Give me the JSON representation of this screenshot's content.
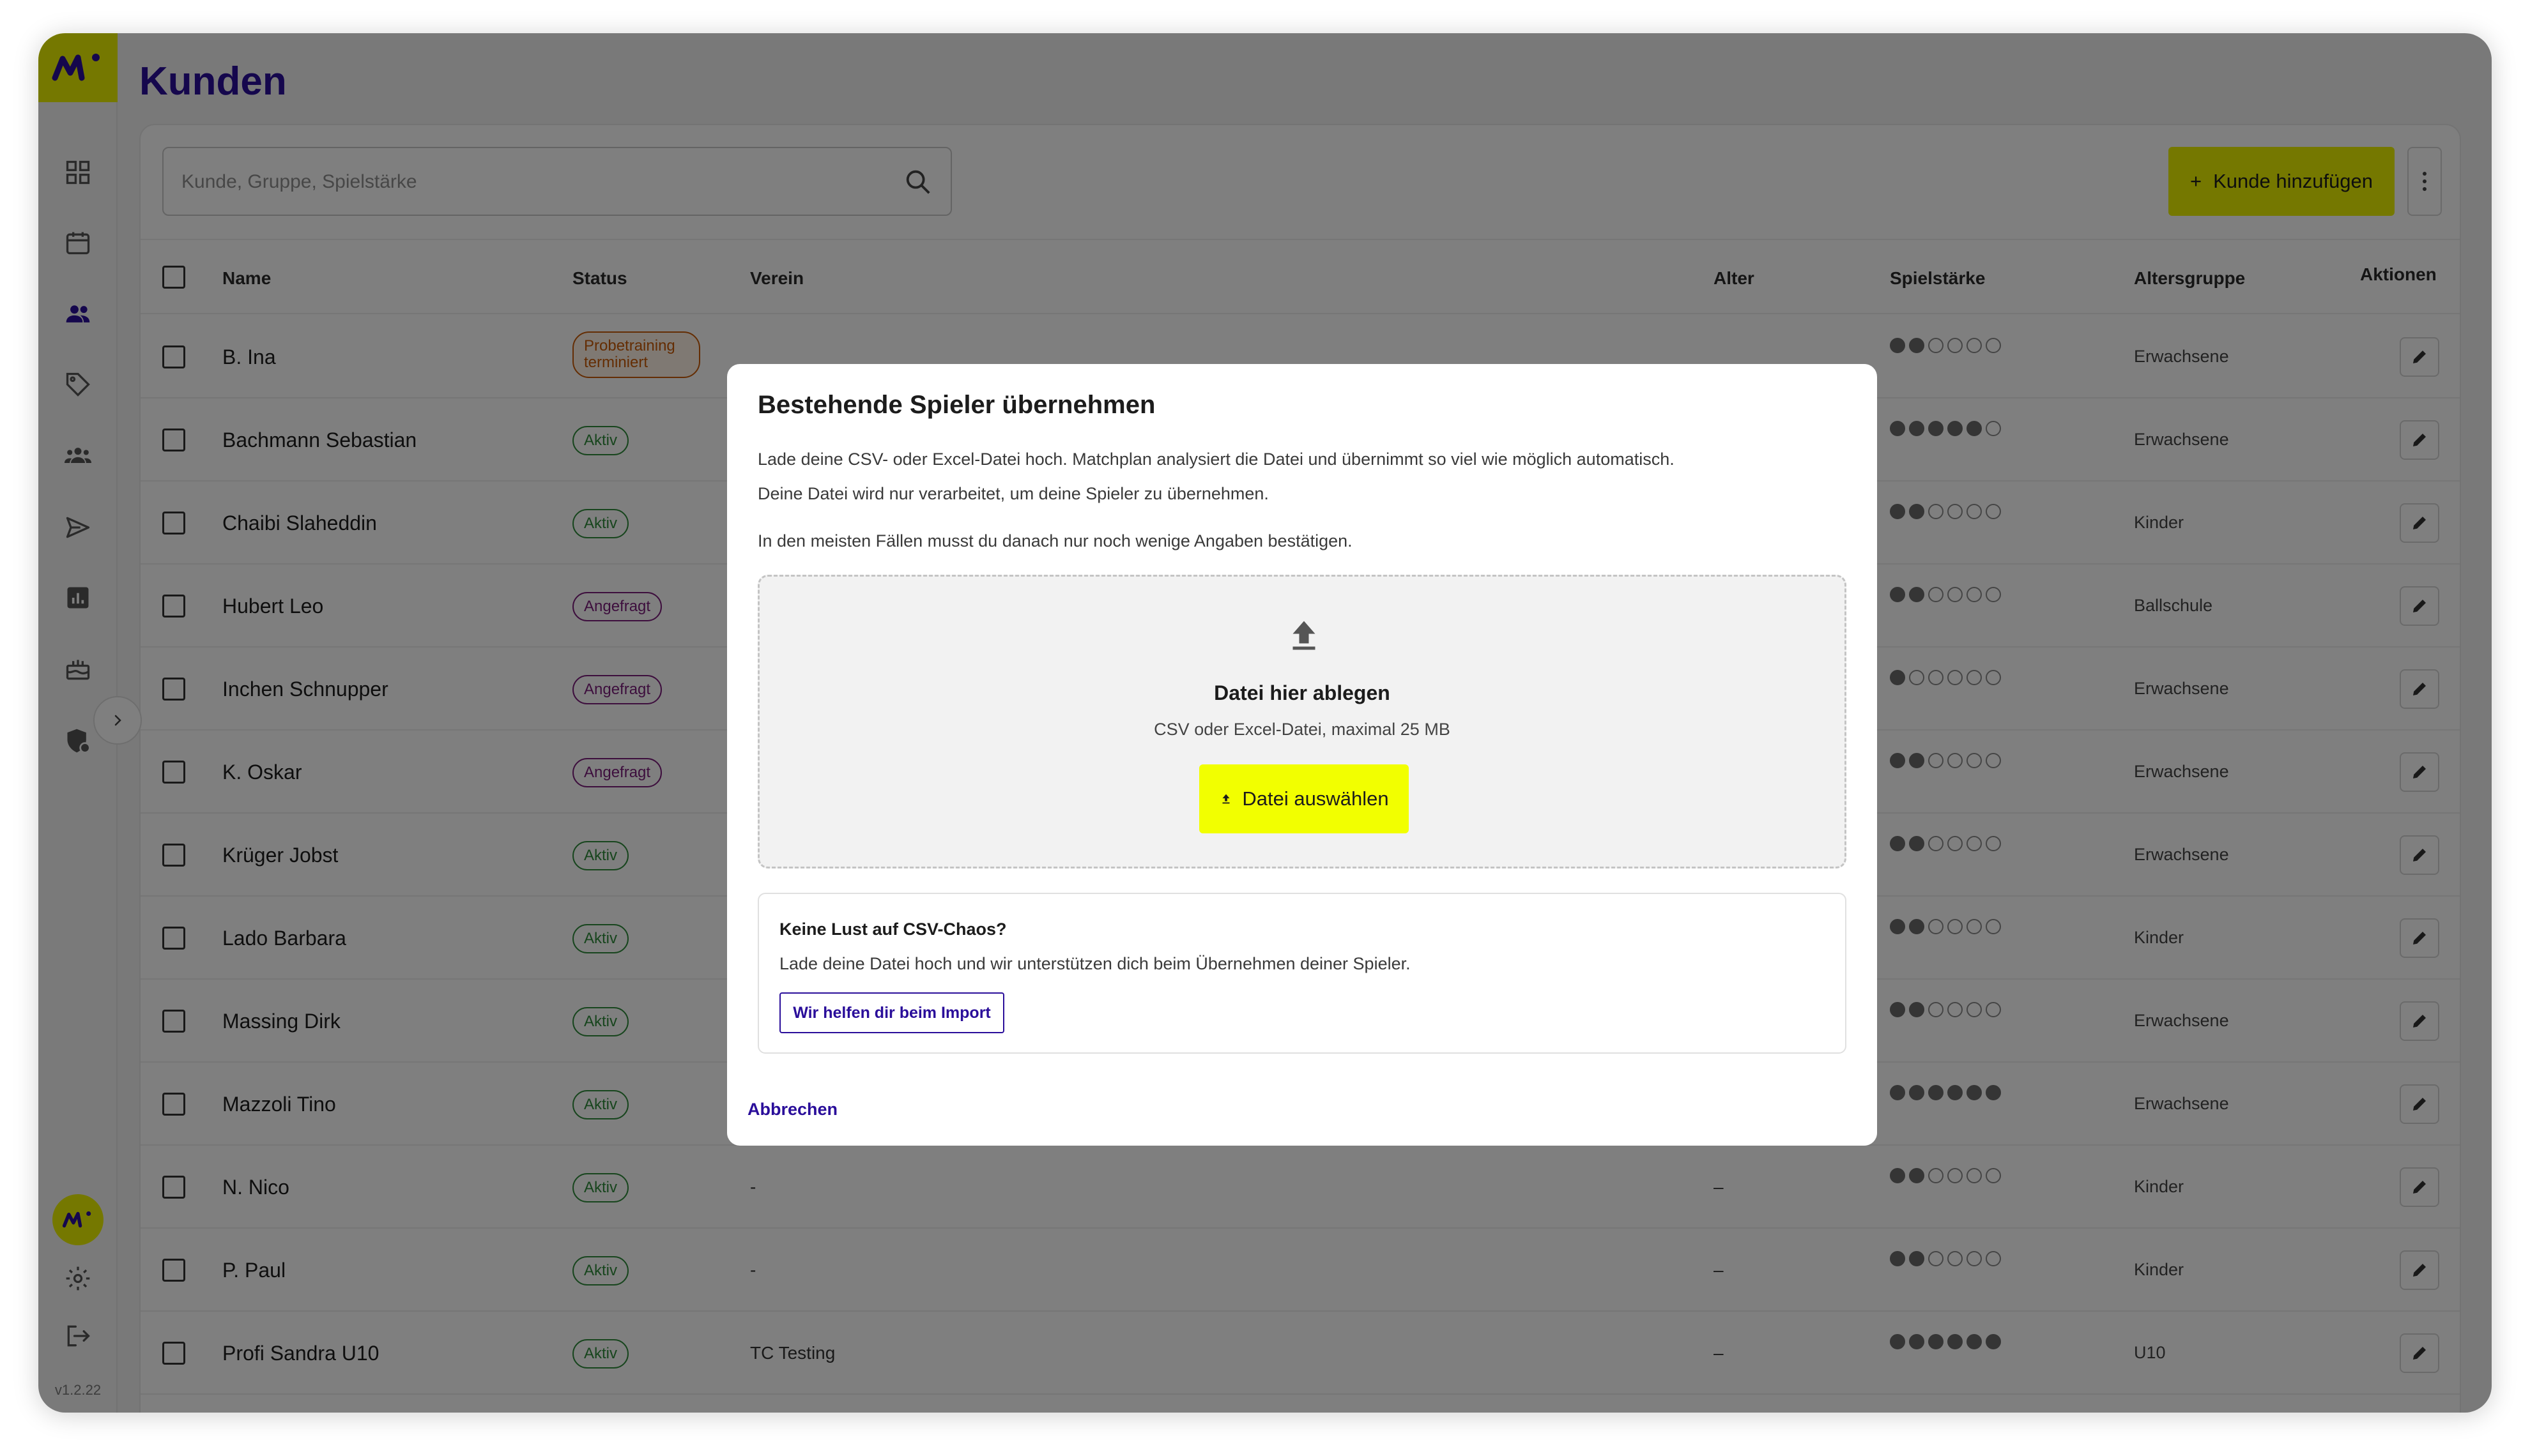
{
  "page": {
    "title": "Kunden",
    "version": "v1.2.22"
  },
  "sidebar": {
    "icons": [
      "dashboard-icon",
      "calendar-icon",
      "users-icon",
      "tag-icon",
      "groups-icon",
      "send-icon",
      "chart-icon",
      "cake-icon",
      "shield-user-icon"
    ],
    "bottom_icons": [
      "settings-icon",
      "logout-icon"
    ]
  },
  "toolbar": {
    "search_placeholder": "Kunde, Gruppe, Spielstärke",
    "add_label": "Kunde hinzufügen"
  },
  "table": {
    "headers": {
      "name": "Name",
      "status": "Status",
      "verein": "Verein",
      "alter": "Alter",
      "spielstaerke": "Spielstärke",
      "altersgruppe": "Altersgruppe",
      "aktionen": "Aktionen"
    },
    "rows": [
      {
        "name": "B. Ina",
        "status": "Probetraining terminiert",
        "status_kind": "probe",
        "verein": "",
        "alter": "",
        "level": 2,
        "age_group": "Erwachsene"
      },
      {
        "name": "Bachmann Sebastian",
        "status": "Aktiv",
        "status_kind": "aktiv",
        "verein": "",
        "alter": "",
        "level": 5,
        "age_group": "Erwachsene"
      },
      {
        "name": "Chaibi Slaheddin",
        "status": "Aktiv",
        "status_kind": "aktiv",
        "verein": "",
        "alter": "",
        "level": 2,
        "age_group": "Kinder"
      },
      {
        "name": "Hubert Leo",
        "status": "Angefragt",
        "status_kind": "angefragt",
        "verein": "",
        "alter": "",
        "level": 2,
        "age_group": "Ballschule"
      },
      {
        "name": "Inchen Schnupper",
        "status": "Angefragt",
        "status_kind": "angefragt",
        "verein": "",
        "alter": "",
        "level": 1,
        "age_group": "Erwachsene"
      },
      {
        "name": "K. Oskar",
        "status": "Angefragt",
        "status_kind": "angefragt",
        "verein": "",
        "alter": "",
        "level": 2,
        "age_group": "Erwachsene"
      },
      {
        "name": "Krüger Jobst",
        "status": "Aktiv",
        "status_kind": "aktiv",
        "verein": "",
        "alter": "",
        "level": 2,
        "age_group": "Erwachsene"
      },
      {
        "name": "Lado Barbara",
        "status": "Aktiv",
        "status_kind": "aktiv",
        "verein": "",
        "alter": "",
        "level": 2,
        "age_group": "Kinder"
      },
      {
        "name": "Massing Dirk",
        "status": "Aktiv",
        "status_kind": "aktiv",
        "verein": "",
        "alter": "",
        "level": 2,
        "age_group": "Erwachsene"
      },
      {
        "name": "Mazzoli Tino",
        "status": "Aktiv",
        "status_kind": "aktiv",
        "verein": "",
        "alter": "",
        "level": 6,
        "age_group": "Erwachsene"
      },
      {
        "name": "N. Nico",
        "status": "Aktiv",
        "status_kind": "aktiv",
        "verein": "-",
        "alter": "–",
        "level": 2,
        "age_group": "Kinder"
      },
      {
        "name": "P. Paul",
        "status": "Aktiv",
        "status_kind": "aktiv",
        "verein": "-",
        "alter": "–",
        "level": 2,
        "age_group": "Kinder"
      },
      {
        "name": "Profi Sandra U10",
        "status": "Aktiv",
        "status_kind": "aktiv",
        "verein": "TC Testing",
        "alter": "–",
        "level": 6,
        "age_group": "U10"
      }
    ]
  },
  "modal": {
    "title": "Bestehende Spieler übernehmen",
    "p1": "Lade deine CSV- oder Excel-Datei hoch. Matchplan analysiert die Datei und übernimmt so viel wie möglich automatisch.",
    "p2": "Deine Datei wird nur verarbeitet, um deine Spieler zu übernehmen.",
    "p3": "In den meisten Fällen musst du danach nur noch wenige Angaben bestätigen.",
    "dropzone": {
      "title": "Datei hier ablegen",
      "subtitle": "CSV oder Excel-Datei, maximal 25 MB",
      "button": "Datei auswählen"
    },
    "help": {
      "title": "Keine Lust auf CSV-Chaos?",
      "text": "Lade deine Datei hoch und wir unterstützen dich beim Übernehmen deiner Spieler.",
      "button": "Wir helfen dir beim Import"
    },
    "cancel": "Abbrechen"
  }
}
